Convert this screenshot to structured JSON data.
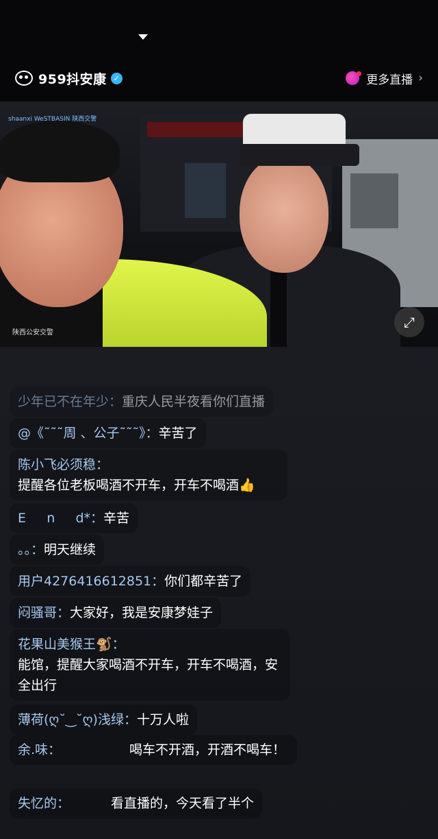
{
  "header": {
    "channel_name": "959抖安康",
    "more_live_label": "更多直播"
  },
  "video": {
    "watermark_top": "shaanxi WeSTBASIN 陕西交警",
    "watermark_bottom": "陕西公安交警"
  },
  "comments": [
    {
      "user": "少年已不在年少：",
      "text": "重庆人民半夜看你们直播"
    },
    {
      "user": "@《˜˜˜周 、公子˜˜˜》：",
      "text": "辛苦了"
    },
    {
      "user": "陈小飞必须稳：",
      "text": "提醒各位老板喝酒不开车，开车不喝酒👍"
    },
    {
      "user": "E     n     d*：",
      "text": "辛苦"
    },
    {
      "user": "。。：",
      "text": "明天继续"
    },
    {
      "user": "用户4276416612851：",
      "text": "你们都辛苦了"
    },
    {
      "user": "闷骚哥：",
      "text": "大家好，我是安康梦娃子"
    },
    {
      "user": "花果山美猴王🐒：",
      "text": "能馆，提醒大家喝酒不开车，开车不喝酒，安全出行"
    },
    {
      "user": "薄荷(ღ˘‿˘ღ)浅绿：",
      "text": "十万人啦"
    },
    {
      "user": "余.味：",
      "text": "喝车不开酒，开酒不喝车！"
    },
    {
      "user": "失忆的：",
      "text": "看直播的，今天看了半个"
    }
  ]
}
